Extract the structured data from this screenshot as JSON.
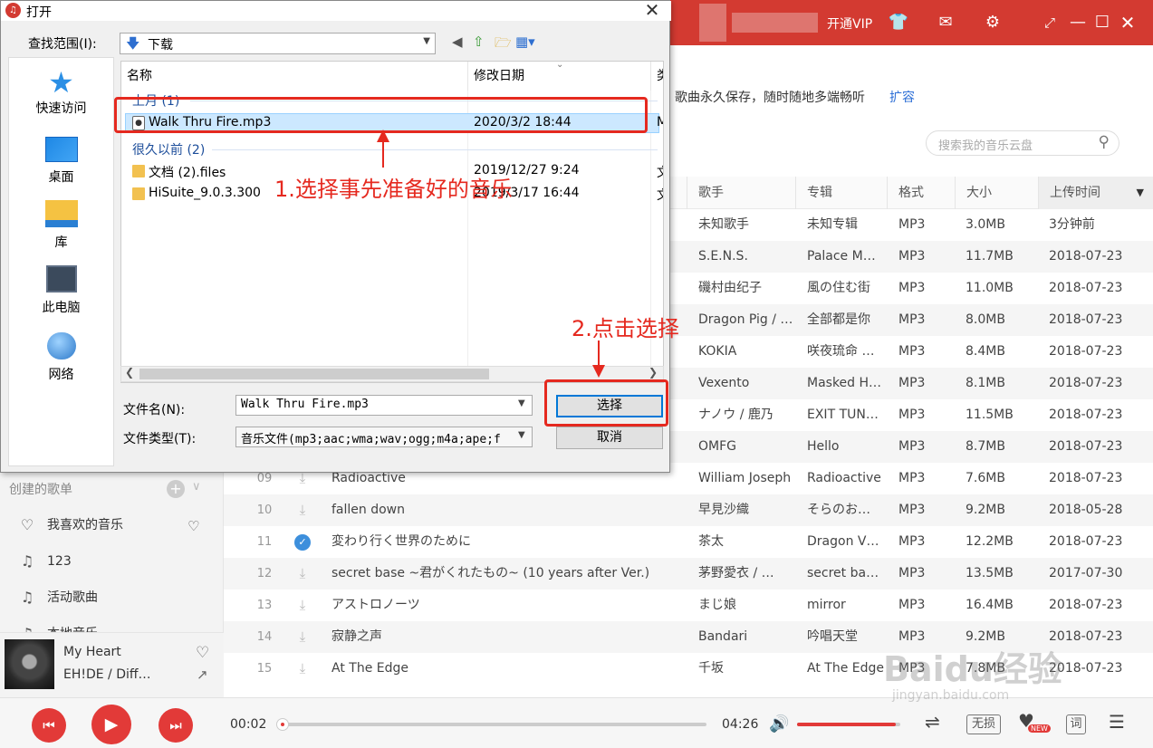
{
  "app": {
    "vip": "开通VIP",
    "banner_text": "歌曲永久保存，随时随地多端畅听",
    "banner_link": "扩容",
    "search_placeholder": "搜索我的音乐云盘",
    "columns": [
      "歌手",
      "专辑",
      "格式",
      "大小",
      "上传时间"
    ],
    "rows": [
      {
        "idx": "",
        "title": "",
        "artist": "未知歌手",
        "album": "未知专辑",
        "format": "MP3",
        "size": "3.0MB",
        "time": "3分钟前"
      },
      {
        "idx": "",
        "title": "",
        "artist": "S.E.N.S.",
        "album": "Palace M…",
        "format": "MP3",
        "size": "11.7MB",
        "time": "2018-07-23"
      },
      {
        "idx": "",
        "title": "",
        "artist": "磯村由纪子",
        "album": "風の住む街",
        "format": "MP3",
        "size": "11.0MB",
        "time": "2018-07-23"
      },
      {
        "idx": "",
        "title": "",
        "artist": "Dragon Pig / …",
        "album": "全部都是你",
        "format": "MP3",
        "size": "8.0MB",
        "time": "2018-07-23"
      },
      {
        "idx": "",
        "title": "",
        "artist": "KOKIA",
        "album": "咲夜琉命 …",
        "format": "MP3",
        "size": "8.4MB",
        "time": "2018-07-23"
      },
      {
        "idx": "",
        "title": "",
        "artist": "Vexento",
        "album": "Masked H…",
        "format": "MP3",
        "size": "8.1MB",
        "time": "2018-07-23"
      },
      {
        "idx": "",
        "title": "",
        "artist": "ナノウ / 鹿乃",
        "album": "EXIT TUN…",
        "format": "MP3",
        "size": "11.5MB",
        "time": "2018-07-23"
      },
      {
        "idx": "",
        "title": "",
        "artist": "OMFG",
        "album": "Hello",
        "format": "MP3",
        "size": "8.7MB",
        "time": "2018-07-23"
      },
      {
        "idx": "09",
        "title": "Radioactive",
        "artist": "William Joseph",
        "album": "Radioactive",
        "format": "MP3",
        "size": "7.6MB",
        "time": "2018-07-23"
      },
      {
        "idx": "10",
        "title": "fallen down",
        "artist": "早見沙織",
        "album": "そらのお…",
        "format": "MP3",
        "size": "9.2MB",
        "time": "2018-05-28"
      },
      {
        "idx": "11",
        "title": "変わり行く世界のために",
        "artist": "茶太",
        "album": "Dragon V…",
        "format": "MP3",
        "size": "12.2MB",
        "time": "2018-07-23"
      },
      {
        "idx": "12",
        "title": "secret base ~君がくれたもの~ (10 years after Ver.)",
        "artist": "茅野愛衣 / …",
        "album": "secret ba…",
        "format": "MP3",
        "size": "13.5MB",
        "time": "2017-07-30"
      },
      {
        "idx": "13",
        "title": "アストロノーツ",
        "artist": "まじ娘",
        "album": "mirror",
        "format": "MP3",
        "size": "16.4MB",
        "time": "2018-07-23"
      },
      {
        "idx": "14",
        "title": "寂静之声",
        "artist": "Bandari",
        "album": "吟唱天堂",
        "format": "MP3",
        "size": "9.2MB",
        "time": "2018-07-23"
      },
      {
        "idx": "15",
        "title": "At The Edge",
        "artist": "千坂",
        "album": "At The Edge",
        "format": "MP3",
        "size": "7.8MB",
        "time": "2018-07-23"
      }
    ],
    "sidebar": {
      "section": "创建的歌单",
      "items": [
        "我喜欢的音乐",
        "123",
        "活动歌曲",
        "本地音乐"
      ]
    },
    "now_playing": {
      "title": "My Heart",
      "artist": "EH!DE / Diff…"
    },
    "player": {
      "current": "00:02",
      "total": "04:26",
      "progress": 0.01,
      "volume": 0.96,
      "lossless": "无损",
      "lyrics": "词",
      "new_badge": "NEW"
    }
  },
  "dialog": {
    "title": "打开",
    "look_in_label": "查找范围(I):",
    "look_in_value": "下载",
    "places": [
      "快速访问",
      "桌面",
      "库",
      "此电脑",
      "网络"
    ],
    "headers": [
      "名称",
      "修改日期",
      "类"
    ],
    "groups": [
      {
        "label": "上月 (1)",
        "items": [
          {
            "name": "Walk Thru Fire.mp3",
            "date": "2020/3/2 18:44",
            "type": "M"
          }
        ]
      },
      {
        "label": "很久以前 (2)",
        "items": [
          {
            "name": "文档 (2).files",
            "date": "2019/12/27 9:24",
            "type": "文"
          },
          {
            "name": "HiSuite_9.0.3.300",
            "date": "2019/3/17 16:44",
            "type": "文"
          }
        ]
      }
    ],
    "filename_label": "文件名(N):",
    "filename_value": "Walk Thru Fire.mp3",
    "filetype_label": "文件类型(T):",
    "filetype_value": "音乐文件(mp3;aac;wma;wav;ogg;m4a;ape;f",
    "select_button": "选择",
    "cancel_button": "取消"
  },
  "annotations": {
    "step1": "1.选择事先准备好的音乐",
    "step2": "2.点击选择"
  },
  "watermark": {
    "main": "Baidu经验",
    "sub": "jingyan.baidu.com"
  },
  "colors": {
    "brand_red": "#d33a31",
    "annotation_red": "#e5291f",
    "accent_blue": "#0078d7"
  }
}
